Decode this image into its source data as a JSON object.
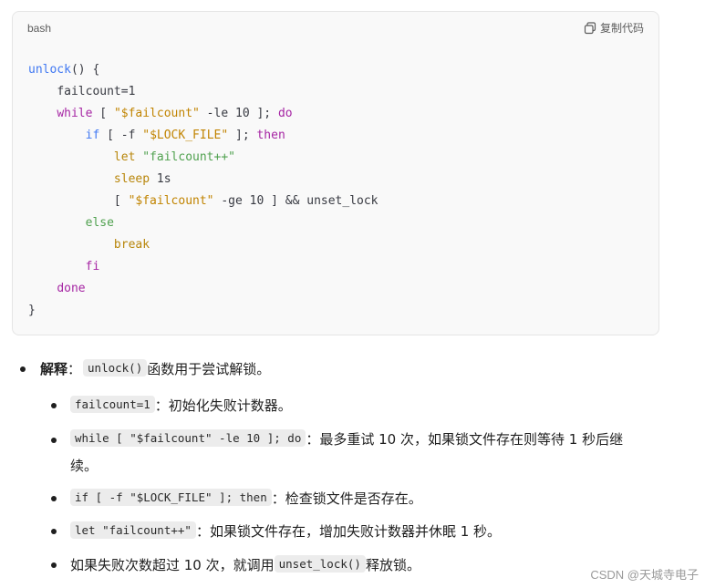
{
  "code_block": {
    "language": "bash",
    "copy_label": "复制代码",
    "lines": [
      "unlock() {",
      "    failcount=1",
      "    while [ \"$failcount\" -le 10 ]; do",
      "        if [ -f \"$LOCK_FILE\" ]; then",
      "            let \"failcount++\"",
      "            sleep 1s",
      "            [ \"$failcount\" -ge 10 ] && unset_lock",
      "        else",
      "            break",
      "        fi",
      "    done",
      "}"
    ],
    "tokens": {
      "fn_name": "unlock",
      "fn_rest": "() {",
      "l2": "failcount=1",
      "while_kw": "while",
      "l3_a": " [ ",
      "l3_str": "\"$failcount\"",
      "l3_b": " -le 10 ]; ",
      "do_kw": "do",
      "if_kw": "if",
      "l4_a": " [ -f ",
      "l4_str": "\"$LOCK_FILE\"",
      "l4_b": " ]; ",
      "then_kw": "then",
      "let_kw": "let",
      "l5_str": "\"failcount++\"",
      "sleep_kw": "sleep",
      "l6_rest": " 1s",
      "l7_a": "[ ",
      "l7_str": "\"$failcount\"",
      "l7_b": " -ge 10 ] && unset_lock",
      "else_kw": "else",
      "break_kw": "break",
      "fi_kw": "fi",
      "done_kw": "done",
      "close": "}"
    }
  },
  "explanation": {
    "title_bold": "解释",
    "title_colon": "：",
    "title_code": "unlock()",
    "title_rest": " 函数用于尝试解锁。",
    "items": [
      {
        "code": "failcount=1",
        "text": "：初始化失败计数器。"
      },
      {
        "code": "while [ \"$failcount\" -le 10 ]; do",
        "text": "：最多重试 10 次，如果锁文件存在则等待 1 秒后继",
        "text2": "续。"
      },
      {
        "code": "if [ -f \"$LOCK_FILE\" ]; then",
        "text": "：检查锁文件是否存在。"
      },
      {
        "code": "let \"failcount++\"",
        "text": "：如果锁文件存在，增加失败计数器并休眠 1 秒。"
      },
      {
        "pre": "如果失败次数超过 10 次，就调用 ",
        "code": "unset_lock()",
        "text": " 释放锁。"
      }
    ]
  },
  "watermark": "CSDN @天城寺电子",
  "colors": {
    "function": "#4078f2",
    "keyword": "#a626a4",
    "string": "#50a14f",
    "builtin": "#b8860b",
    "card_bg": "#f9f9f9"
  },
  "icons": {
    "copy": "copy-icon"
  }
}
